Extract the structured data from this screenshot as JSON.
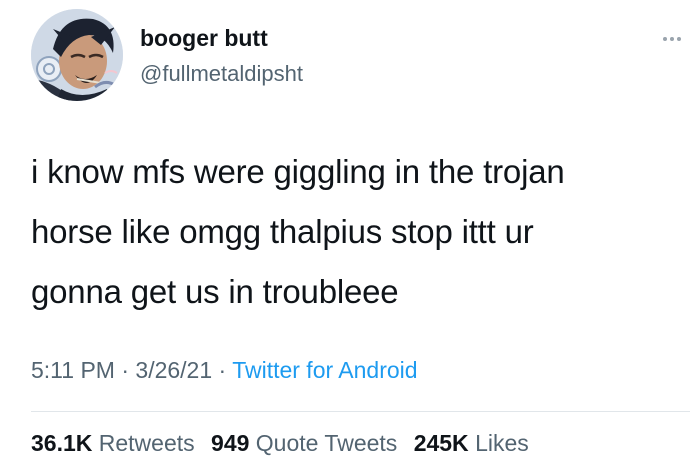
{
  "author": {
    "display_name": "booger butt",
    "handle": "@fullmetaldipsht",
    "avatar_icon": "profile-avatar-icon"
  },
  "more_icon": "more-options-icon",
  "tweet": {
    "lines": [
      "i know mfs were giggling in the trojan",
      "horse like omgg thalpius stop ittt ur",
      "gonna get us in troubleee"
    ]
  },
  "meta": {
    "time": "5:11 PM",
    "separator": " · ",
    "date": "3/26/21",
    "source": "Twitter for Android"
  },
  "stats": {
    "retweets_count": "36.1K",
    "retweets_label": "Retweets",
    "quotes_count": "949",
    "quotes_label": "Quote Tweets",
    "likes_count": "245K",
    "likes_label": "Likes"
  },
  "colors": {
    "text_primary": "#0f1419",
    "text_secondary": "#536471",
    "link": "#1d9bf0",
    "divider": "#e1e6ea"
  }
}
